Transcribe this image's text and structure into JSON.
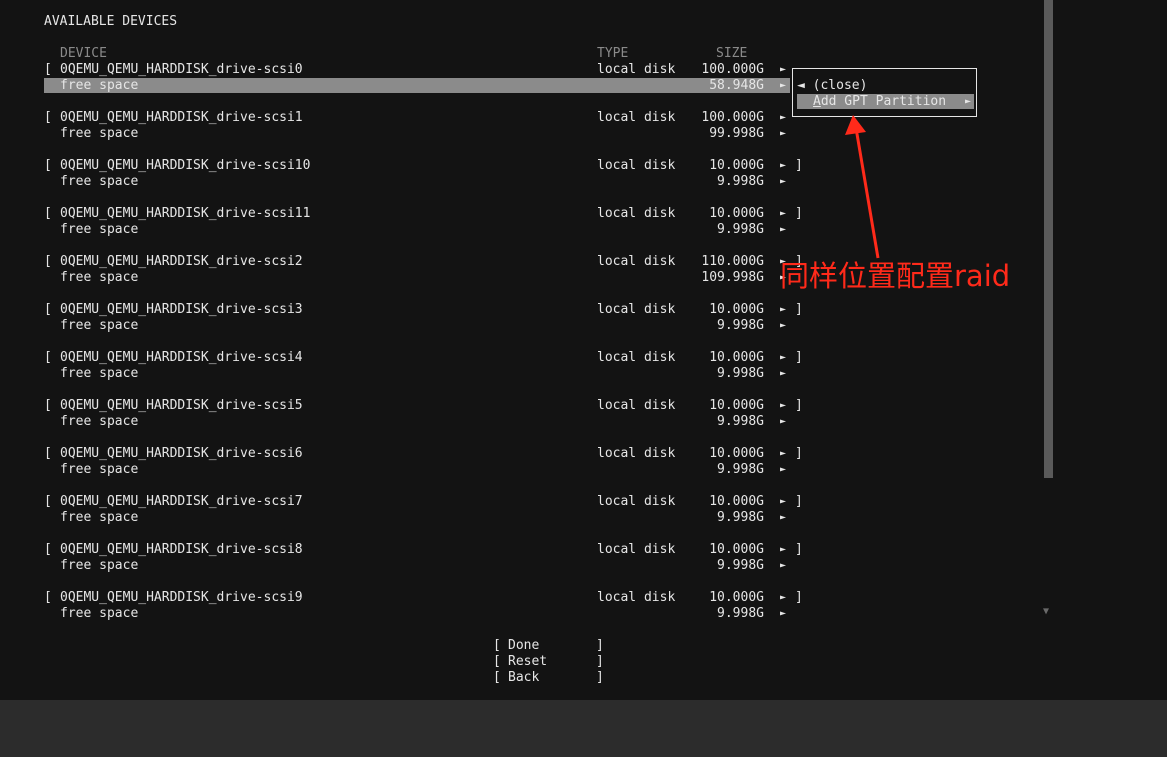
{
  "section_title": "AVAILABLE DEVICES",
  "columns": {
    "device": "DEVICE",
    "type": "TYPE",
    "size": "SIZE"
  },
  "disks": [
    {
      "bracket": "[",
      "name": "0QEMU_QEMU_HARDDISK_drive-scsi0",
      "type": "local disk",
      "size": "100.000G",
      "arrow": "►",
      "close": "",
      "free_label": "free space",
      "free_size": "58.948G"
    },
    {
      "bracket": "[",
      "name": "0QEMU_QEMU_HARDDISK_drive-scsi1",
      "type": "local disk",
      "size": "100.000G",
      "arrow": "►",
      "close": "",
      "free_label": "free space",
      "free_size": "99.998G"
    },
    {
      "bracket": "[",
      "name": "0QEMU_QEMU_HARDDISK_drive-scsi10",
      "type": "local disk",
      "size": "10.000G",
      "arrow": "►",
      "close": "]",
      "free_label": "free space",
      "free_size": "9.998G"
    },
    {
      "bracket": "[",
      "name": "0QEMU_QEMU_HARDDISK_drive-scsi11",
      "type": "local disk",
      "size": "10.000G",
      "arrow": "►",
      "close": "]",
      "free_label": "free space",
      "free_size": "9.998G"
    },
    {
      "bracket": "[",
      "name": "0QEMU_QEMU_HARDDISK_drive-scsi2",
      "type": "local disk",
      "size": "110.000G",
      "arrow": "►",
      "close": "]",
      "free_label": "free space",
      "free_size": "109.998G"
    },
    {
      "bracket": "[",
      "name": "0QEMU_QEMU_HARDDISK_drive-scsi3",
      "type": "local disk",
      "size": "10.000G",
      "arrow": "►",
      "close": "]",
      "free_label": "free space",
      "free_size": "9.998G"
    },
    {
      "bracket": "[",
      "name": "0QEMU_QEMU_HARDDISK_drive-scsi4",
      "type": "local disk",
      "size": "10.000G",
      "arrow": "►",
      "close": "]",
      "free_label": "free space",
      "free_size": "9.998G"
    },
    {
      "bracket": "[",
      "name": "0QEMU_QEMU_HARDDISK_drive-scsi5",
      "type": "local disk",
      "size": "10.000G",
      "arrow": "►",
      "close": "]",
      "free_label": "free space",
      "free_size": "9.998G"
    },
    {
      "bracket": "[",
      "name": "0QEMU_QEMU_HARDDISK_drive-scsi6",
      "type": "local disk",
      "size": "10.000G",
      "arrow": "►",
      "close": "]",
      "free_label": "free space",
      "free_size": "9.998G"
    },
    {
      "bracket": "[",
      "name": "0QEMU_QEMU_HARDDISK_drive-scsi7",
      "type": "local disk",
      "size": "10.000G",
      "arrow": "►",
      "close": "]",
      "free_label": "free space",
      "free_size": "9.998G"
    },
    {
      "bracket": "[",
      "name": "0QEMU_QEMU_HARDDISK_drive-scsi8",
      "type": "local disk",
      "size": "10.000G",
      "arrow": "►",
      "close": "]",
      "free_label": "free space",
      "free_size": "9.998G"
    },
    {
      "bracket": "[",
      "name": "0QEMU_QEMU_HARDDISK_drive-scsi9",
      "type": "local disk",
      "size": "10.000G",
      "arrow": "►",
      "close": "]",
      "free_label": "free space",
      "free_size": "9.998G"
    }
  ],
  "context_menu": {
    "close_arrow": "◄",
    "close_label": "(close)",
    "add_label_hotkey": "A",
    "add_label_rest": "dd GPT Partition",
    "add_arrow": "►"
  },
  "buttons": [
    {
      "left": "[",
      "label": "Done",
      "right": "]"
    },
    {
      "left": "[",
      "label": "Reset",
      "right": "]"
    },
    {
      "left": "[",
      "label": "Back",
      "right": "]"
    }
  ],
  "scroll_indicator": "▼",
  "annotation": "同样位置配置raid",
  "colors": {
    "background": "#131313",
    "highlight": "#8b8b8b",
    "annotation": "#ff2a1a",
    "text": "#e6e6e6"
  }
}
